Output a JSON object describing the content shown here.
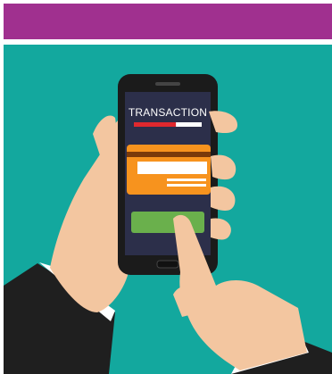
{
  "header": {
    "color": "#a0308f"
  },
  "scene": {
    "background": "#13a89e",
    "screen": {
      "title": "TRANSACTION",
      "progress_fraction": 0.62,
      "card_color": "#f7931e",
      "button_color": "#6ab04c"
    }
  }
}
